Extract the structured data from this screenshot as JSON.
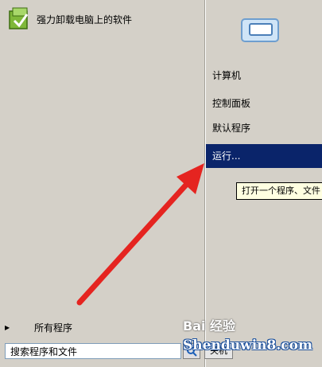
{
  "start_menu": {
    "pinned_program": {
      "label": "强力卸载电脑上的软件",
      "icon": "uninstall-software-icon"
    },
    "all_programs": {
      "label": "所有程序",
      "icon": "triangle-right-icon"
    },
    "search": {
      "placeholder": "搜索程序和文件",
      "value": "搜索程序和文件"
    },
    "search_button": {
      "icon": "search-icon"
    },
    "shutdown_button": {
      "label": "关机"
    },
    "right_items": [
      {
        "label": "计算机"
      },
      {
        "label": "控制面板"
      },
      {
        "label": "默认程序"
      },
      {
        "label": "运行..."
      }
    ],
    "tooltip": "打开一个程序、文件",
    "user_picture": {
      "icon": "user-picture-icon"
    }
  },
  "annotation": {
    "arrow_color": "#e52420",
    "icon": "red-arrow"
  },
  "watermark": {
    "text": "Bai 经验",
    "site": "Shenduwin8.com"
  },
  "colors": {
    "selection": "#0a246a",
    "tooltip_bg": "#ffffe1",
    "menu_bg": "#d4d0c8"
  }
}
